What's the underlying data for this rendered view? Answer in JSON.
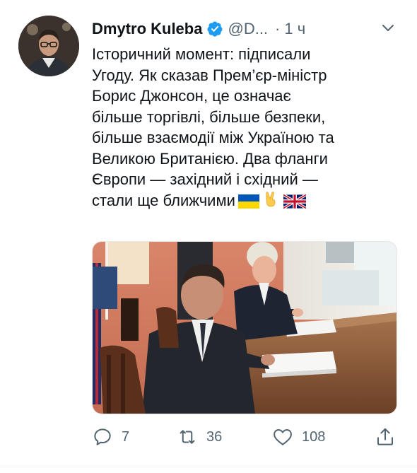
{
  "tweet": {
    "display_name": "Dmytro Kuleba",
    "handle": "@D...",
    "separator": "·",
    "time": "1 ч",
    "text": "Історичний момент: підписали\nУгоду. Як сказав Прем’єр-міністр\nБорис Джонсон, це означає\nбільше торгівлі, більше безпеки,\nбільше взаємодії між Україною та\nВеликою Британією. Два фланги\nЄвропи — західний і східний —\nстали ще ближчими",
    "emojis": [
      "flag-ukraine",
      "victory-hand",
      "flag-uk"
    ],
    "verified": true
  },
  "actions": {
    "reply_count": "7",
    "retweet_count": "36",
    "like_count": "108"
  },
  "icons": {
    "verified": "verified-badge-icon",
    "menu": "chevron-down-icon",
    "reply": "reply-icon",
    "retweet": "retweet-icon",
    "like": "heart-icon",
    "share": "share-icon"
  },
  "colors": {
    "verified": "#1d9bf0",
    "text": "#0f1419",
    "secondary": "#536471"
  }
}
